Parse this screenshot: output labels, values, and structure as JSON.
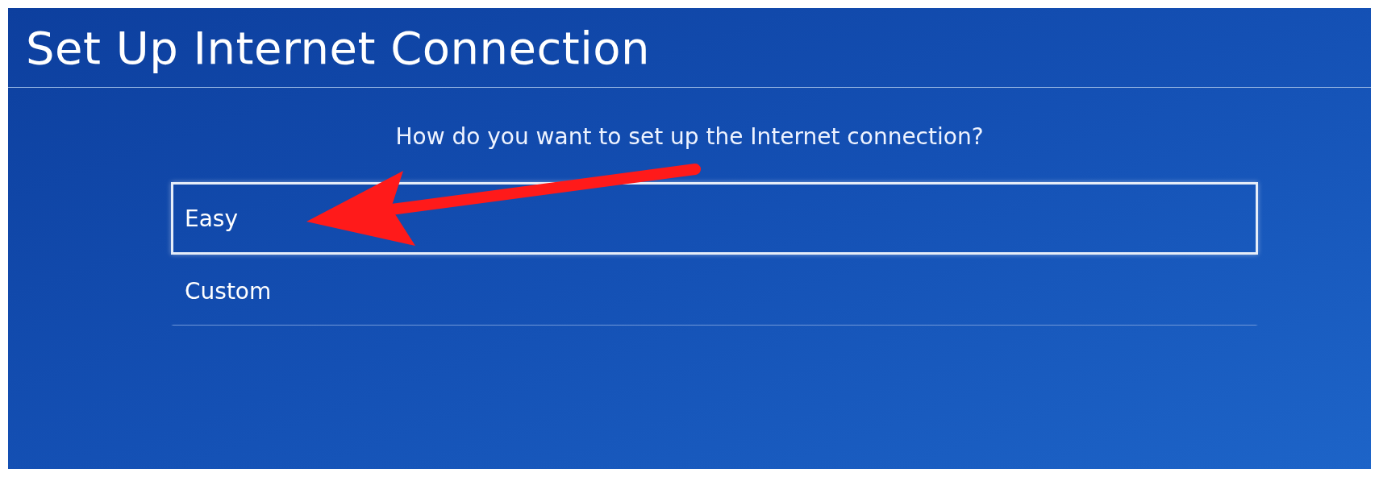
{
  "title": "Set Up Internet Connection",
  "question": "How do you want to set up the Internet connection?",
  "options": [
    {
      "label": "Easy",
      "selected": true
    },
    {
      "label": "Custom",
      "selected": false
    }
  ]
}
